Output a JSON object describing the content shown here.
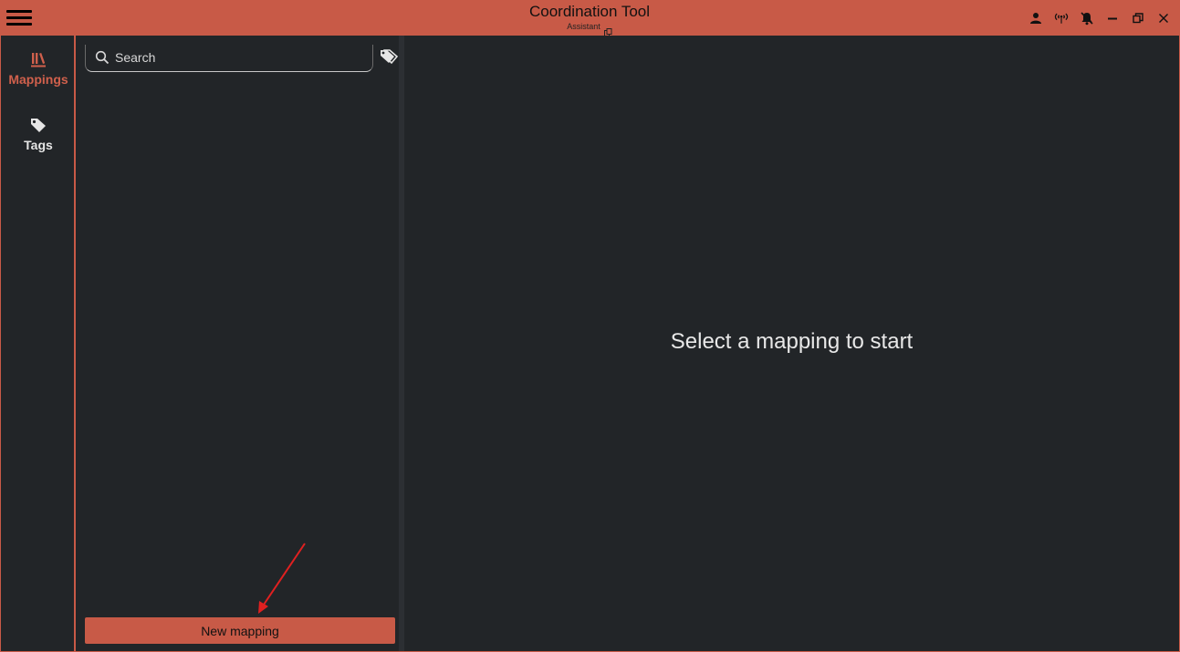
{
  "titlebar": {
    "title": "Coordination Tool",
    "subtitle": "Assistant",
    "icons": [
      "menu-icon",
      "user-icon",
      "broadcast-icon",
      "bell-off-icon",
      "minimize-icon",
      "restore-icon",
      "close-icon"
    ]
  },
  "rail": {
    "items": [
      {
        "label": "Mappings",
        "icon": "library-icon",
        "active": true
      },
      {
        "label": "Tags",
        "icon": "tag-icon",
        "active": false
      }
    ]
  },
  "list": {
    "search_placeholder": "Search",
    "new_button_label": "New mapping"
  },
  "main": {
    "empty_message": "Select a mapping to start"
  },
  "colors": {
    "accent": "#c85a47",
    "background": "#222528",
    "text": "#e8e8e8",
    "annotation_arrow": "#e02020"
  }
}
